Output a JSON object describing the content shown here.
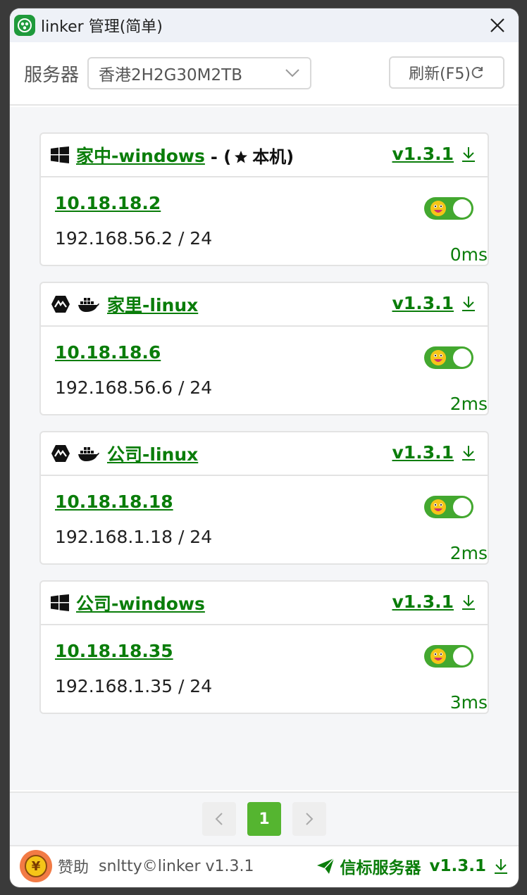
{
  "window": {
    "title": "linker 管理(简单)"
  },
  "toolbar": {
    "server_label": "服务器",
    "server_selected": "香港2H2G30M2TB",
    "refresh_label": "刷新(F5)"
  },
  "devices": [
    {
      "os_icons": [
        "windows-icon"
      ],
      "name": "家中-windows",
      "local_tag_prefix": "- (",
      "local_tag_text": "本机)",
      "version": "v1.3.1",
      "vip": "10.18.18.2",
      "lan": "192.168.56.2 / 24",
      "latency": "0ms",
      "enabled": true
    },
    {
      "os_icons": [
        "linux-icon",
        "docker-icon"
      ],
      "name": "家里-linux",
      "version": "v1.3.1",
      "vip": "10.18.18.6",
      "lan": "192.168.56.6 / 24",
      "latency": "2ms",
      "enabled": true
    },
    {
      "os_icons": [
        "linux-icon",
        "docker-icon"
      ],
      "name": "公司-linux",
      "version": "v1.3.1",
      "vip": "10.18.18.18",
      "lan": "192.168.1.18 / 24",
      "latency": "2ms",
      "enabled": true
    },
    {
      "os_icons": [
        "windows-icon"
      ],
      "name": "公司-windows",
      "version": "v1.3.1",
      "vip": "10.18.18.35",
      "lan": "192.168.1.35 / 24",
      "latency": "3ms",
      "enabled": true
    }
  ],
  "pagination": {
    "current": "1"
  },
  "footer": {
    "sponsor_label": "赞助",
    "sponsor_glyph": "¥",
    "copyright": "snltty©linker v1.3.1",
    "beacon_label": "信标服务器",
    "beacon_version": "v1.3.1"
  },
  "colors": {
    "accent_green": "#0a7d0a",
    "toggle_green": "#43a82f",
    "page_green": "#55b530"
  }
}
